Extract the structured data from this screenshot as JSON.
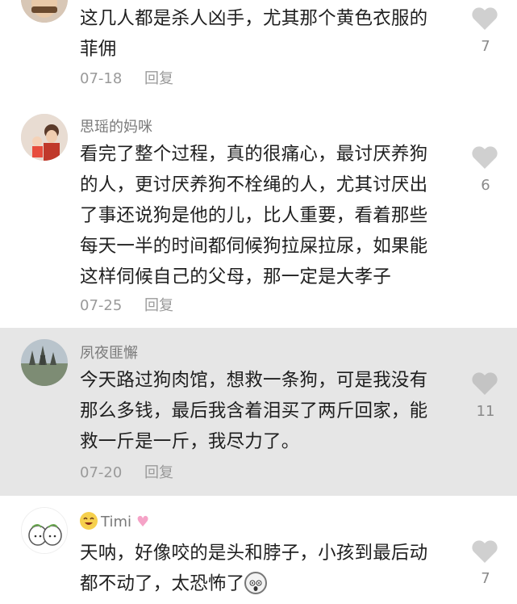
{
  "comments": [
    {
      "username": "",
      "lines": [
        "这几人都是杀人凶手，尤其那个黄色衣服的",
        "菲佣"
      ],
      "date": "07-18",
      "reply_label": "回复",
      "likes": "7"
    },
    {
      "username": "思瑶的妈咪",
      "lines": [
        "看完了整个过程，真的很痛心，最讨厌养狗",
        "的人，更讨厌养狗不栓绳的人，尤其讨厌出",
        "了事还说狗是他的儿，比人重要，看着那些",
        "每天一半的时间都伺候狗拉屎拉尿，如果能",
        "这样伺候自己的父母，那一定是大孝子"
      ],
      "date": "07-25",
      "reply_label": "回复",
      "likes": "6"
    },
    {
      "username": "夙夜匪懈",
      "lines": [
        "今天路过狗肉馆，想救一条狗，可是我没有",
        "那么多钱，最后我含着泪买了两斤回家，能",
        "救一斤是一斤，我尽力了。"
      ],
      "date": "07-20",
      "reply_label": "回复",
      "likes": "11"
    },
    {
      "username": "Timi",
      "lines": [
        "天呐，好像咬的是头和脖子，小孩到最后动",
        "都不动了，太恐怖了"
      ],
      "date": "",
      "reply_label": "",
      "likes": "7"
    }
  ],
  "colors": {
    "highlight_bg": "#e6e6e6",
    "heart_gray": "#d0d0d0"
  },
  "icons": [
    "heart-icon",
    "avatar",
    "laughing-emoji-icon",
    "pink-heart-icon",
    "shocked-emoji-icon"
  ]
}
